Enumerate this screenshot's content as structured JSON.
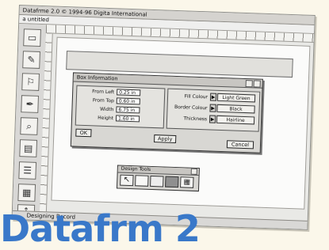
{
  "app": {
    "title": "Datafrme 2.0 © 1994-96 Digita International",
    "doc_title": "a  untitled",
    "status": "Designing Record"
  },
  "dialog": {
    "title": "Box Information",
    "from_left_label": "From Left",
    "from_left_value": "0.25 in",
    "from_top_label": "From Top",
    "from_top_value": "0.60 in",
    "width_label": "Width",
    "width_value": "6.75 in",
    "height_label": "Height",
    "height_value": "1.60 in",
    "fill_label": "Fill Colour",
    "fill_value": "Light Green",
    "border_label": "Border Colour",
    "border_value": "Black",
    "thickness_label": "Thickness",
    "thickness_value": "Hairline",
    "ok": "OK",
    "apply": "Apply",
    "cancel": "Cancel"
  },
  "palette": {
    "title": "Design Tools"
  },
  "overlay": {
    "headline": "Datafrm 2"
  }
}
